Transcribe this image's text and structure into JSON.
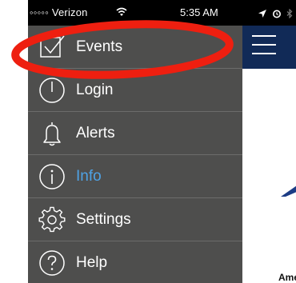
{
  "status_bar": {
    "carrier": "◦◦◦◦◦ Verizon",
    "time": "5:35 AM"
  },
  "menu": {
    "items": [
      {
        "label": "Events",
        "icon": "calendar-check-icon",
        "active": false
      },
      {
        "label": "Login",
        "icon": "power-icon",
        "active": false
      },
      {
        "label": "Alerts",
        "icon": "bell-icon",
        "active": false
      },
      {
        "label": "Info",
        "icon": "info-icon",
        "active": true
      },
      {
        "label": "Settings",
        "icon": "gear-icon",
        "active": false
      },
      {
        "label": "Help",
        "icon": "help-icon",
        "active": false
      }
    ]
  },
  "app": {
    "partial_text": "Ame"
  },
  "colors": {
    "drawer_bg": "#4e4e4d",
    "active_text": "#4ea3e6",
    "header_bg": "#112a57",
    "annotation_red": "#ee1f10"
  }
}
